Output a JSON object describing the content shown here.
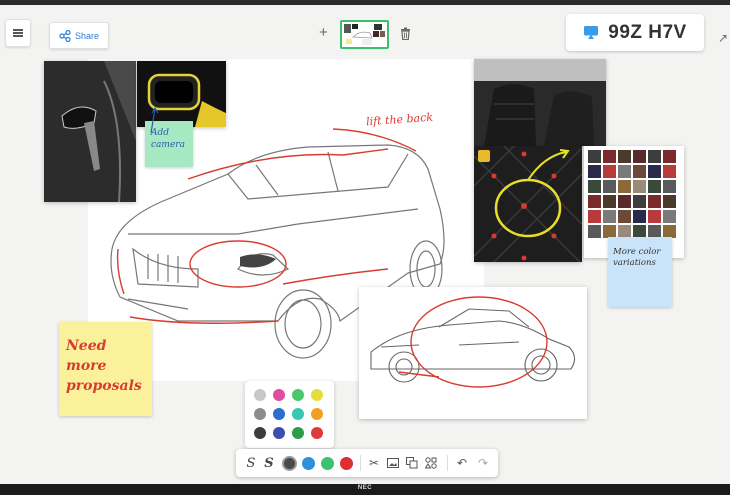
{
  "toolbar_top": {
    "menu_icon": "hamburger-menu-icon",
    "share_label": "Share",
    "add_page_label": "+",
    "code": "99Z H7V",
    "code_icon": "cast-screen-icon",
    "exit_icon": "arrow-out-icon"
  },
  "notes": {
    "add_camera": "Add camera",
    "lift_back": "lift the back",
    "more_color": "More color variations",
    "need_more": "Need more proposals"
  },
  "palette": {
    "colors": [
      "#c8c8c8",
      "#e04ca0",
      "#4bc66a",
      "#e3de3a",
      "#8c8c8c",
      "#2a6fd0",
      "#39c7b2",
      "#f0a023",
      "#3c3c3c",
      "#3d4fae",
      "#2f9c4c",
      "#de3b3b"
    ]
  },
  "bottom_toolbar": {
    "pen_colors": [
      "#4a4a4a",
      "#2f8fd8",
      "#3cc26a",
      "#dc3030"
    ],
    "tools": [
      "pen-icon",
      "highlighter-icon",
      "scissors-icon",
      "image-icon",
      "copy-icon",
      "shapes-icon",
      "undo-icon",
      "redo-icon"
    ]
  },
  "brand": "NEC",
  "colors": {
    "accent": "#2a7fd4",
    "selected_thumb": "#3cbf6a",
    "note_yellow": "#fbf19a",
    "note_green": "#a6e8c1",
    "note_blue": "#c9e3f8",
    "ink_red": "#d83b32"
  }
}
